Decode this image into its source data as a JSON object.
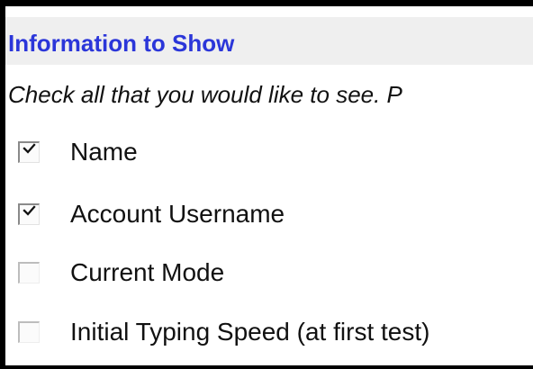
{
  "section": {
    "title": "Information to Show",
    "instructions": "Check all that you would like to see. P"
  },
  "options": [
    {
      "label": "Name",
      "checked": true
    },
    {
      "label": "Account Username",
      "checked": true
    },
    {
      "label": "Current Mode",
      "checked": false
    },
    {
      "label": "Initial Typing Speed (at first test)",
      "checked": false
    }
  ],
  "colors": {
    "title": "#2b36d9",
    "header_background": "#efefef",
    "frame_border": "#000000"
  },
  "icons": {
    "checked": "checkmark-icon"
  }
}
